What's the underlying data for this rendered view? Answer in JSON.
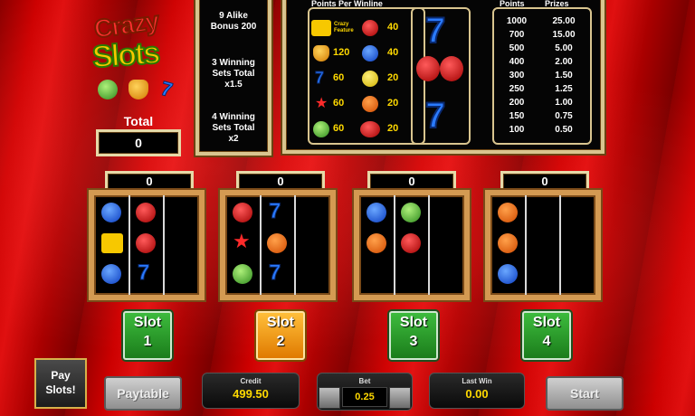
{
  "logo": {
    "line1": "Crazy",
    "line2": "Slots"
  },
  "total": {
    "label": "Total",
    "value": "0"
  },
  "bonus": {
    "lines": [
      "9 Alike",
      "Bonus 200",
      "3 Winning",
      "Sets Total",
      "x1.5",
      "4 Winning",
      "Sets Total",
      "x2"
    ]
  },
  "paytable": {
    "ppw_header": "Points Per Winline",
    "ppw_feature_label": "Crazy Feature",
    "ppw_values": [
      "40",
      "120",
      "40",
      "60",
      "20",
      "60",
      "20",
      "60",
      "20"
    ],
    "points_header": "Points",
    "prizes_header": "Prizes",
    "rows": [
      {
        "points": "1000",
        "prize": "25.00"
      },
      {
        "points": "700",
        "prize": "15.00"
      },
      {
        "points": "500",
        "prize": "5.00"
      },
      {
        "points": "400",
        "prize": "2.00"
      },
      {
        "points": "300",
        "prize": "1.50"
      },
      {
        "points": "250",
        "prize": "1.25"
      },
      {
        "points": "200",
        "prize": "1.00"
      },
      {
        "points": "150",
        "prize": "0.75"
      },
      {
        "points": "100",
        "prize": "0.50"
      }
    ]
  },
  "slots": [
    {
      "counter": "0",
      "word": "Slot",
      "num": "1",
      "color": "green"
    },
    {
      "counter": "0",
      "word": "Slot",
      "num": "2",
      "color": "orange"
    },
    {
      "counter": "0",
      "word": "Slot",
      "num": "3",
      "color": "green"
    },
    {
      "counter": "0",
      "word": "Slot",
      "num": "4",
      "color": "green"
    }
  ],
  "bottom": {
    "pay_slots_line1": "Pay",
    "pay_slots_line2": "Slots!",
    "paytable_label": "Paytable",
    "credit_label": "Credit",
    "credit_value": "499.50",
    "bet_label": "Bet",
    "bet_value": "0.25",
    "lastwin_label": "Last Win",
    "lastwin_value": "0.00",
    "start_label": "Start"
  },
  "colors": {
    "accent": "#ffd900",
    "frame": "#d49a52",
    "background": "#c00000"
  }
}
